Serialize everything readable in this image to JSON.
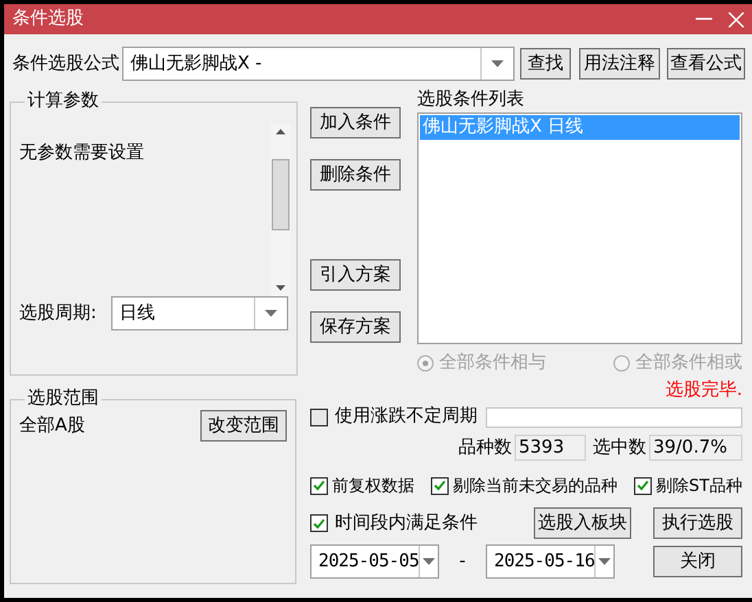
{
  "window": {
    "title": "条件选股"
  },
  "formula": {
    "label": "条件选股公式",
    "value": "佛山无影脚战X  -"
  },
  "top_buttons": [
    "查找",
    "用法注释",
    "查看公式"
  ],
  "params_group": {
    "title": "计算参数",
    "message": "无参数需要设置"
  },
  "period": {
    "label": "选股周期:",
    "value": "日线"
  },
  "scope_group": {
    "title": "选股范围",
    "value": "全部A股",
    "button": "改变范围"
  },
  "action_buttons": [
    "加入条件",
    "删除条件",
    "引入方案",
    "保存方案"
  ],
  "condition_list": {
    "title": "选股条件列表",
    "items": [
      {
        "label": "佛山无影脚战X  日线",
        "selected": true
      }
    ]
  },
  "logic_options": [
    {
      "label": "全部条件相与",
      "selected": true,
      "disabled": true
    },
    {
      "label": "全部条件相或",
      "selected": false,
      "disabled": true
    }
  ],
  "status": "选股完毕.",
  "variable_period": {
    "label": "使用涨跌不定周期",
    "checked": false
  },
  "stats": [
    {
      "label": "品种数",
      "value": "5393"
    },
    {
      "label": "选中数",
      "value": "39/0.7%"
    }
  ],
  "options": [
    {
      "label": "前复权数据",
      "checked": true
    },
    {
      "label": "剔除当前未交易的品种",
      "checked": true
    },
    {
      "label": "剔除ST品种",
      "checked": true
    }
  ],
  "time_range": {
    "label": "时间段内满足条件",
    "checked": true,
    "start": "2025-05-05",
    "separator": "-",
    "end": "2025-05-16"
  },
  "bottom_buttons": [
    "选股入板块",
    "执行选股",
    "关闭"
  ]
}
